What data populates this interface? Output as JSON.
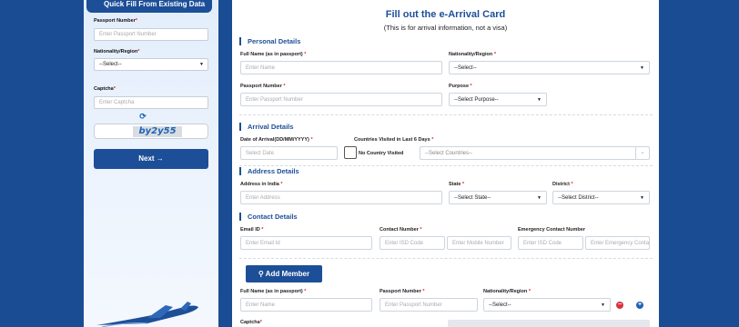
{
  "sidebar": {
    "heading": "Quick Fill From Existing Data",
    "passport_label": "Passport Number",
    "passport_placeholder": "Enter Passport Number",
    "nationality_label": "Nationality/Region",
    "nationality_value": "--Select--",
    "captcha_label": "Captcha",
    "captcha_placeholder": "Enter Captcha",
    "captcha_text": "by2y55",
    "next_label": "Next →",
    "required_mark": "*",
    "icons": [
      "refresh-icon",
      "airplane-illustration"
    ]
  },
  "form": {
    "title": "Fill out the e-Arrival Card",
    "subtitle": "(This is for arrival information, not a visa)",
    "required_mark": "*",
    "personal": {
      "heading": "Personal Details",
      "fullname_label": "Full Name (as in passport)",
      "fullname_placeholder": "Enter Name",
      "nationality_label": "Nationality/Region",
      "nationality_value": "--Select--",
      "passport_label": "Passport Number",
      "passport_placeholder": "Enter Passport Number",
      "purpose_label": "Purpose",
      "purpose_value": "--Select Purpose--"
    },
    "arrival": {
      "heading": "Arrival Details",
      "date_label": "Date of Arrival(DD/MM/YYYY)",
      "date_placeholder": "Select Date",
      "countries_label": "Countries Visited in Last 6 Days",
      "no_country_label": "No Country Visited",
      "countries_placeholder": "--Select Countries--"
    },
    "address": {
      "heading": "Address Details",
      "address_label": "Address in India",
      "address_placeholder": "Enter Address",
      "state_label": "State",
      "state_value": "--Select State--",
      "district_label": "District",
      "district_value": "--Select District--"
    },
    "contact": {
      "heading": "Contact Details",
      "email_label": "Email ID",
      "email_placeholder": "Enter Email Id",
      "contact_label": "Contact Number",
      "isd_placeholder": "Enter ISD Code",
      "mobile_placeholder": "Enter Mobile Number",
      "emergency_label": "Emergency Contact Number",
      "emergency_isd_placeholder": "Enter ISD Code",
      "emergency_number_placeholder": "Enter Emergency Contact Number"
    },
    "members": {
      "add_label": "Add Member",
      "fullname_label": "Full Name (as in passport)",
      "fullname_placeholder": "Enter Name",
      "passport_label": "Passport Number",
      "passport_placeholder": "Enter Passport Number",
      "nationality_label": "Nationality/Region",
      "nationality_value": "--Select--",
      "remove_symbol": "−",
      "add_symbol": "+"
    },
    "captcha_label": "Captcha",
    "colors": {
      "primary": "#1d4f98",
      "required": "#e02424",
      "remove": "#d9333f",
      "add": "#1e63b5"
    }
  }
}
